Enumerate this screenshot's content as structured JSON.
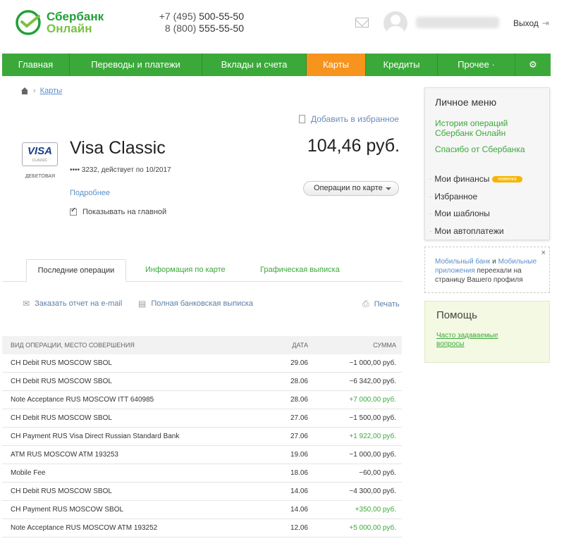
{
  "header": {
    "logo_line1": "Сбербанк",
    "logo_line2": "Онлайн",
    "phone1_prefix": "+7 (495) ",
    "phone1_number": "500-55-50",
    "phone2_prefix": "8 (800) ",
    "phone2_number": "555-55-50",
    "logout": "Выход"
  },
  "nav": {
    "items": [
      {
        "label": "Главная"
      },
      {
        "label": "Переводы и платежи"
      },
      {
        "label": "Вклады и счета"
      },
      {
        "label": "Карты"
      },
      {
        "label": "Кредиты"
      },
      {
        "label": "Прочее ·"
      },
      {
        "label": "⚙"
      }
    ],
    "active": "Карты"
  },
  "breadcrumb": {
    "current": "Карты"
  },
  "favorites_link": "Добавить в избранное",
  "card": {
    "logo": "VISA",
    "logo_sub": "CLASSIC",
    "type": "ДЕБЕТОВАЯ",
    "name": "Visa Classic",
    "info": "•••• 3232, действует по 10/2017",
    "balance": "104,46 руб.",
    "more_link": "Подробнее",
    "operations_button": "Операции по карте",
    "show_on_main": "Показывать на главной"
  },
  "tabs": [
    {
      "label": "Последние операции"
    },
    {
      "label": "Информация по карте"
    },
    {
      "label": "Графическая выписка"
    }
  ],
  "actions": {
    "email_report": "Заказать отчет на e-mail",
    "full_statement": "Полная банковская выписка",
    "print": "Печать"
  },
  "table": {
    "headers": [
      "ВИД ОПЕРАЦИИ, МЕСТО СОВЕРШЕНИЯ",
      "ДАТА",
      "СУММА"
    ],
    "rows": [
      {
        "desc": "CH Debit RUS MOSCOW SBOL",
        "date": "29.06",
        "amount": "−1 000,00 руб."
      },
      {
        "desc": "CH Debit RUS MOSCOW SBOL",
        "date": "28.06",
        "amount": "−6 342,00 руб."
      },
      {
        "desc": "Note Acceptance RUS MOSCOW ITT 640985",
        "date": "28.06",
        "amount": "+7 000,00 руб."
      },
      {
        "desc": "CH Debit RUS MOSCOW SBOL",
        "date": "27.06",
        "amount": "−1 500,00 руб."
      },
      {
        "desc": "CH Payment RUS Visa Direct Russian Standard Bank",
        "date": "27.06",
        "amount": "+1 922,00 руб."
      },
      {
        "desc": "ATM RUS MOSCOW ATM 193253",
        "date": "19.06",
        "amount": "−1 000,00 руб."
      },
      {
        "desc": "Mobile Fee",
        "date": "18.06",
        "amount": "−60,00 руб."
      },
      {
        "desc": "CH Debit RUS MOSCOW SBOL",
        "date": "14.06",
        "amount": "−4 300,00 руб."
      },
      {
        "desc": "CH Payment RUS MOSCOW SBOL",
        "date": "14.06",
        "amount": "+350,00 руб."
      },
      {
        "desc": "Note Acceptance RUS MOSCOW ATM 193252",
        "date": "12.06",
        "amount": "+5 000,00 руб."
      }
    ]
  },
  "personal_menu": {
    "title": "Личное меню",
    "link1": "История операций Сбербанк Онлайн",
    "link2": "Спасибо от Сбербанка",
    "items": [
      {
        "label": "Мои финансы"
      },
      {
        "label": "Избранное"
      },
      {
        "label": "Мои шаблоны"
      },
      {
        "label": "Мои автоплатежи"
      }
    ],
    "badge": "новинка"
  },
  "notice": {
    "link1": "Мобильный банк",
    "and": " и ",
    "link2": "Мобильные приложения",
    "text": " переехали на страницу Вашего профиля",
    "close": "×"
  },
  "help": {
    "title": "Помощь",
    "link": "Часто задаваемые вопросы"
  },
  "colors": {
    "brand_green": "#3ba93a",
    "active_tab_orange": "#f7941d",
    "link_blue": "#5b8fcb"
  }
}
